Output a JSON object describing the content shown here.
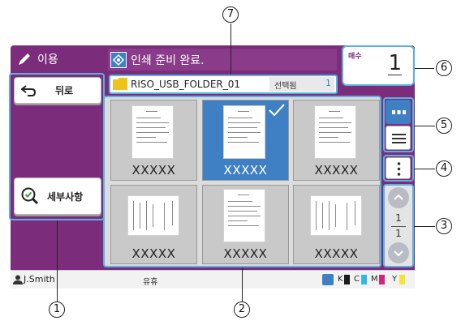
{
  "header": {
    "mode_label": "이용",
    "status_message": "인쇄 준비 완료.",
    "copies_label": "매수",
    "copies_value": "1"
  },
  "left_panel": {
    "back_label": "뒤로",
    "details_label": "세부사항"
  },
  "folder_bar": {
    "folder_name": "RISO_USB_FOLDER_01",
    "selected_label": "선택됨",
    "selected_count": "1"
  },
  "thumbnails": [
    {
      "name": "XXXXX",
      "selected": false
    },
    {
      "name": "XXXXX",
      "selected": true
    },
    {
      "name": "XXXXX",
      "selected": false
    },
    {
      "name": "XXXXX",
      "selected": false
    },
    {
      "name": "XXXXX",
      "selected": false
    },
    {
      "name": "XXXXX",
      "selected": false
    }
  ],
  "pager": {
    "current": "1",
    "total": "1"
  },
  "footer": {
    "user": "J.Smith",
    "status": "유휴",
    "inks": [
      {
        "label": "K",
        "color": "#1a1a1a"
      },
      {
        "label": "C",
        "color": "#35b6e8"
      },
      {
        "label": "M",
        "color": "#d4237a"
      },
      {
        "label": "Y",
        "color": "#f2e33a"
      }
    ]
  },
  "callouts": [
    "1",
    "2",
    "3",
    "4",
    "5",
    "6",
    "7"
  ],
  "colors": {
    "frame": "#7b2d7b",
    "highlight": "#3f80c4",
    "callout_border": "#5ab0e0"
  }
}
